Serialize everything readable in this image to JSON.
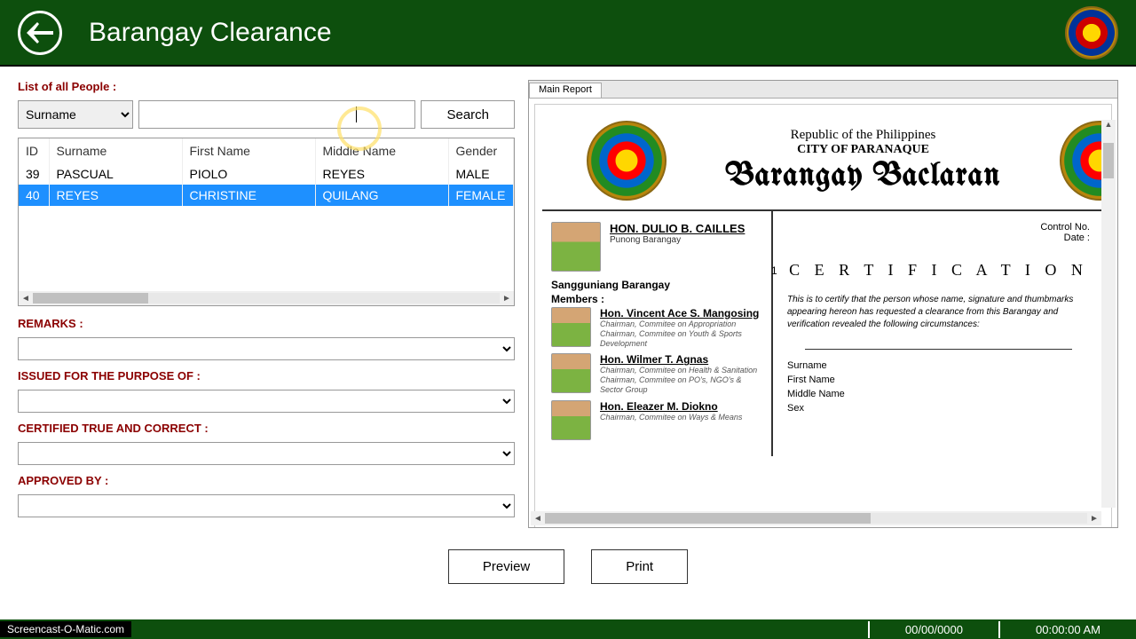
{
  "header": {
    "title": "Barangay Clearance"
  },
  "left": {
    "list_label": "List of all People :",
    "search_by": "Surname",
    "search_value": "",
    "search_btn": "Search",
    "columns": {
      "id": "ID",
      "surname": "Surname",
      "first": "First Name",
      "middle": "Middle Name",
      "gender": "Gender"
    },
    "rows": [
      {
        "id": "39",
        "surname": "PASCUAL",
        "first": "PIOLO",
        "middle": "REYES",
        "gender": "MALE",
        "selected": false
      },
      {
        "id": "40",
        "surname": "REYES",
        "first": "CHRISTINE",
        "middle": "QUILANG",
        "gender": "FEMALE",
        "selected": true
      }
    ],
    "remarks_label": "REMARKS :",
    "purpose_label": "ISSUED FOR THE PURPOSE OF :",
    "certified_label": "CERTIFIED TRUE AND CORRECT :",
    "approved_label": "APPROVED BY :"
  },
  "report": {
    "tab": "Main Report",
    "republic": "Republic of the Philippines",
    "city": "CITY OF PARANAQUE",
    "barangay": "Barangay Baclaran",
    "control": "Control No.",
    "date": "Date :",
    "page": "1",
    "chairman": {
      "name": "HON. DULIO B. CAILLES",
      "title": "Punong Barangay"
    },
    "council_label": "Sangguniang Barangay",
    "members_label": "Members :",
    "members": [
      {
        "name": "Hon. Vincent Ace S. Mangosing",
        "desc": "Chairman, Commitee on Appropriation\nChairman, Commitee on Youth & Sports Development"
      },
      {
        "name": "Hon. Wilmer T. Agnas",
        "desc": "Chairman, Commitee on Health & Sanitation\nChairman, Commitee on PO's, NGO's & Sector Group"
      },
      {
        "name": "Hon. Eleazer M. Diokno",
        "desc": "Chairman, Commitee on Ways & Means"
      }
    ],
    "cert_title": "C E R T I F I C A T I O N",
    "cert_body": "This is to certify that the person whose name, signature and thumbmarks appearing hereon has requested a clearance from this Barangay and verification revealed the following circumstances:",
    "fields": {
      "surname": "Surname",
      "first": "First Name",
      "middle": "Middle Name",
      "sex": "Sex"
    }
  },
  "buttons": {
    "preview": "Preview",
    "print": "Print"
  },
  "footer": {
    "brand": "Screencast-O-Matic.com",
    "date": "00/00/0000",
    "time": "00:00:00 AM"
  }
}
